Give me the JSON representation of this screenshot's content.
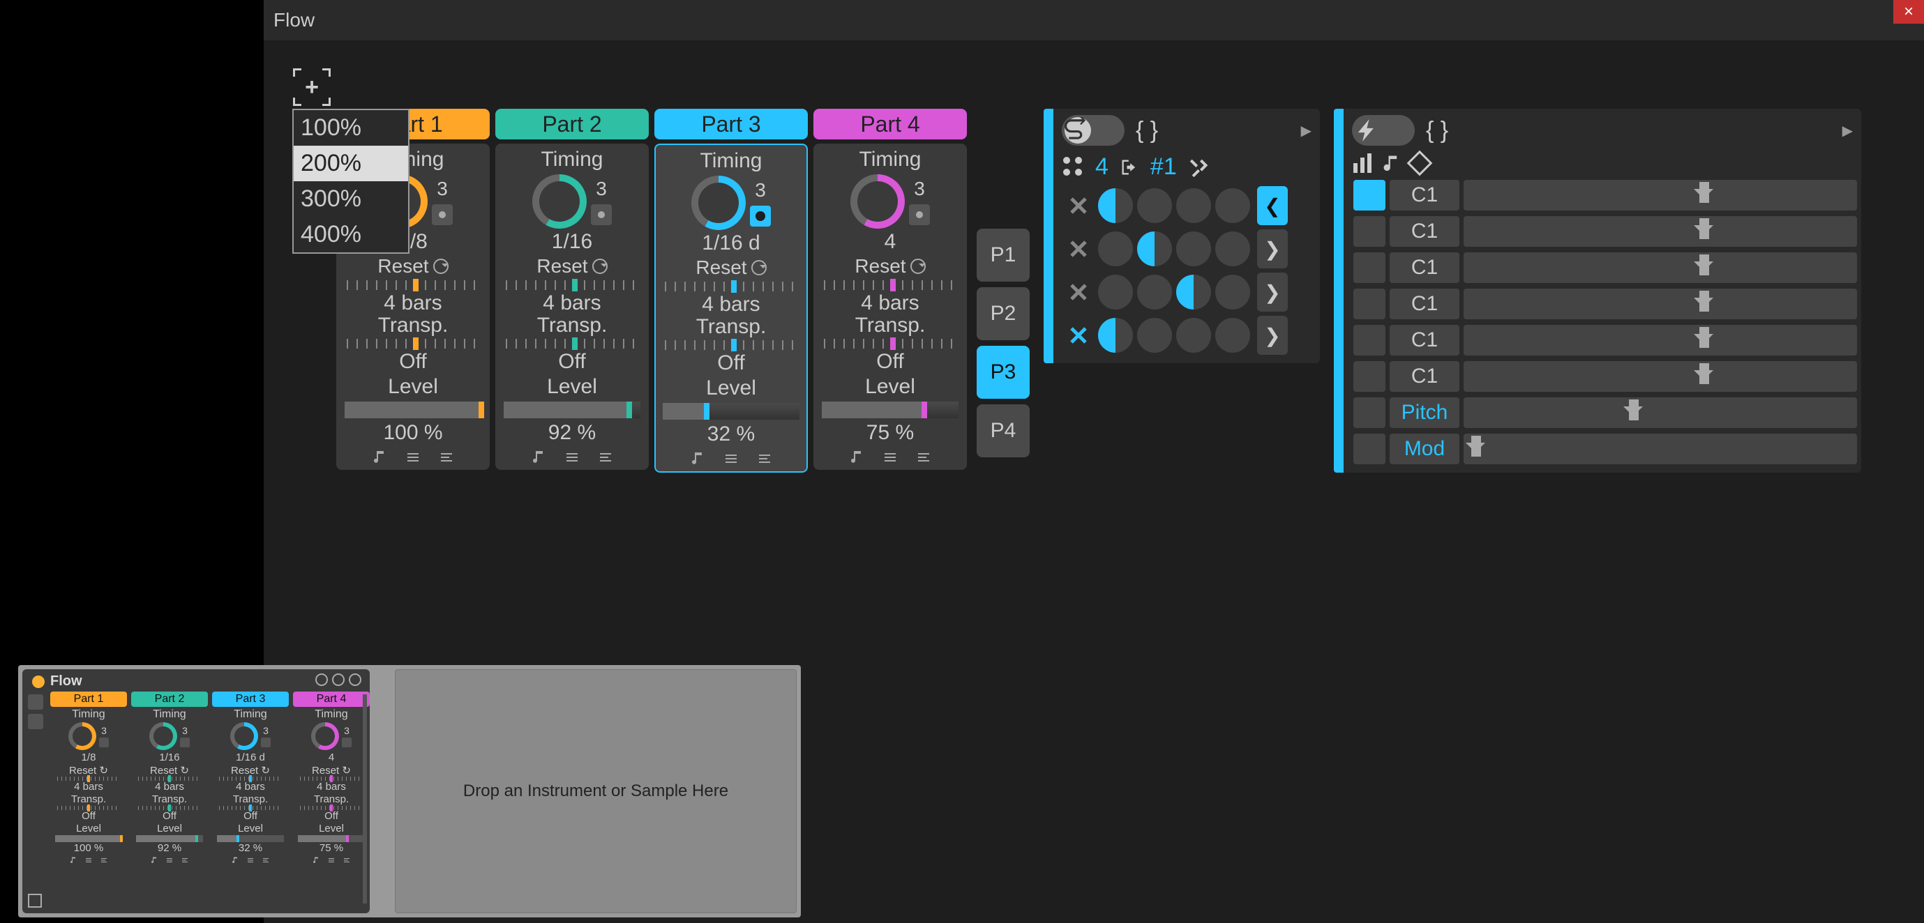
{
  "window": {
    "title": "Flow",
    "close": "×"
  },
  "zoom": {
    "options": [
      "100%",
      "200%",
      "300%",
      "400%"
    ],
    "hovered": 1
  },
  "parts": [
    {
      "name": "Part 1",
      "color": "#ffa629",
      "timing": "Timing",
      "num": "3",
      "denom": "1/8",
      "reset": "Reset",
      "bars": "4 bars",
      "transp": "Transp.",
      "off": "Off",
      "level_lbl": "Level",
      "level": "100 %",
      "level_pct": 100,
      "dot_on": false,
      "selected": false,
      "tick_pos": 50
    },
    {
      "name": "Part 2",
      "color": "#2ebfa5",
      "timing": "Timing",
      "num": "3",
      "denom": "1/16",
      "reset": "Reset",
      "bars": "4 bars",
      "transp": "Transp.",
      "off": "Off",
      "level_lbl": "Level",
      "level": "92 %",
      "level_pct": 92,
      "dot_on": false,
      "selected": false,
      "tick_pos": 50
    },
    {
      "name": "Part 3",
      "color": "#29c3ff",
      "timing": "Timing",
      "num": "3",
      "denom": "1/16 d",
      "reset": "Reset",
      "bars": "4 bars",
      "transp": "Transp.",
      "off": "Off",
      "level_lbl": "Level",
      "level": "32 %",
      "level_pct": 32,
      "dot_on": true,
      "selected": true,
      "tick_pos": 50
    },
    {
      "name": "Part 4",
      "color": "#d858d8",
      "timing": "Timing",
      "num": "3",
      "denom": "4",
      "reset": "Reset",
      "bars": "4 bars",
      "transp": "Transp.",
      "off": "Off",
      "level_lbl": "Level",
      "level": "75 %",
      "level_pct": 75,
      "dot_on": false,
      "selected": false,
      "tick_pos": 50
    }
  ],
  "ptabs": [
    "P1",
    "P2",
    "P3",
    "P4"
  ],
  "ptab_active": 2,
  "gridpanel": {
    "braces": "{ }",
    "count": "4",
    "preset": "#1",
    "rows": [
      {
        "x_color": "#888",
        "cells": [
          "half",
          "off",
          "off",
          "off"
        ],
        "nav_on": true,
        "dir": "left"
      },
      {
        "x_color": "#888",
        "cells": [
          "off",
          "half",
          "off",
          "off"
        ],
        "nav_on": false,
        "dir": "right"
      },
      {
        "x_color": "#888",
        "cells": [
          "off",
          "off",
          "half",
          "off"
        ],
        "nav_on": false,
        "dir": "right"
      },
      {
        "x_color": "#29c3ff",
        "cells": [
          "half",
          "off",
          "off",
          "off"
        ],
        "nav_on": false,
        "dir": "right"
      }
    ]
  },
  "lanepanel": {
    "braces": "{ }",
    "lanes": [
      {
        "sq_on": true,
        "name": "C1",
        "cls": "",
        "pos": 60
      },
      {
        "sq_on": false,
        "name": "C1",
        "cls": "",
        "pos": 60
      },
      {
        "sq_on": false,
        "name": "C1",
        "cls": "",
        "pos": 60
      },
      {
        "sq_on": false,
        "name": "C1",
        "cls": "",
        "pos": 60
      },
      {
        "sq_on": false,
        "name": "C1",
        "cls": "",
        "pos": 60
      },
      {
        "sq_on": false,
        "name": "C1",
        "cls": "",
        "pos": 60
      },
      {
        "sq_on": false,
        "name": "Pitch",
        "cls": "bl",
        "pos": 42
      },
      {
        "sq_on": false,
        "name": "Mod",
        "cls": "bl",
        "pos": 2
      }
    ]
  },
  "thumb": {
    "title": "Flow",
    "drop": "Drop an Instrument or Sample Here",
    "parts": [
      {
        "name": "Part 1",
        "color": "#ffa629",
        "denom": "1/8",
        "level": "100 %",
        "pct": 100
      },
      {
        "name": "Part 2",
        "color": "#2ebfa5",
        "denom": "1/16",
        "level": "92 %",
        "pct": 92
      },
      {
        "name": "Part 3",
        "color": "#29c3ff",
        "denom": "1/16 d",
        "level": "32 %",
        "pct": 32
      },
      {
        "name": "Part 4",
        "color": "#d858d8",
        "denom": "4",
        "level": "75 %",
        "pct": 75
      }
    ],
    "rows": [
      "Timing",
      "Reset",
      "4 bars",
      "Transp.",
      "Off",
      "Level"
    ],
    "num": "3"
  }
}
